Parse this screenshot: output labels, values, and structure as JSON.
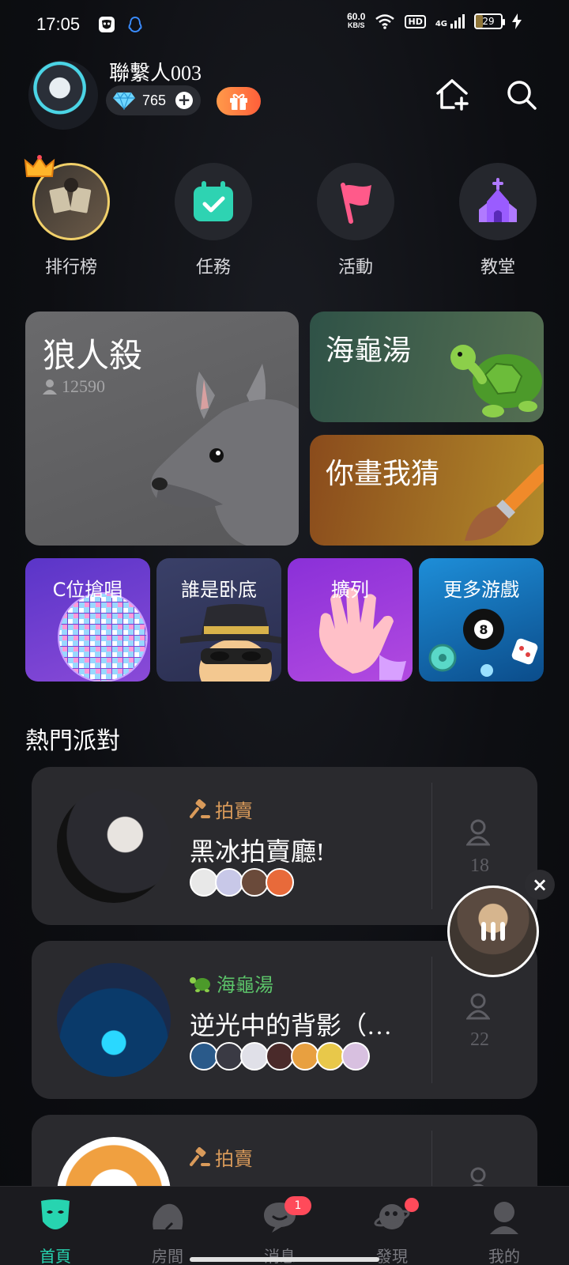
{
  "status_bar": {
    "time": "17:05",
    "speed_value": "60.0",
    "speed_unit": "KB/S",
    "hd": "HD",
    "network": "4G",
    "battery": "29"
  },
  "header": {
    "username": "聯繫人003",
    "diamonds": "765"
  },
  "quick_actions": [
    {
      "label": "排行榜",
      "icon": "crown-avatar-icon"
    },
    {
      "label": "任務",
      "icon": "calendar-check-icon"
    },
    {
      "label": "活動",
      "icon": "flag-icon"
    },
    {
      "label": "教堂",
      "icon": "church-icon"
    }
  ],
  "games": {
    "werewolf": {
      "title": "狼人殺",
      "players": "12590"
    },
    "turtle_soup": {
      "title": "海龜湯"
    },
    "draw_guess": {
      "title": "你畫我猜"
    },
    "c_sing": {
      "title": "C位搶唱"
    },
    "spy": {
      "title": "誰是卧底"
    },
    "lineup": {
      "title": "擴列"
    },
    "more": {
      "title": "更多游戲"
    }
  },
  "section": {
    "hot_parties": "熱門派對"
  },
  "parties": [
    {
      "tag": "拍賣",
      "tag_color": "#d99a5a",
      "title": "黑冰拍賣廳!",
      "count": "18"
    },
    {
      "tag": "海龜湯",
      "tag_color": "#5cc46a",
      "title": "逆光中的背影（…",
      "count": "22"
    },
    {
      "tag": "拍賣",
      "tag_color": "#d99a5a",
      "title": "",
      "count": ""
    }
  ],
  "nav": [
    {
      "label": "首頁",
      "active": true
    },
    {
      "label": "房間"
    },
    {
      "label": "消息",
      "badge": "1"
    },
    {
      "label": "發現",
      "dot": true
    },
    {
      "label": "我的"
    }
  ],
  "colors": {
    "accent": "#27d4b0",
    "badge": "#ff4a5a"
  }
}
